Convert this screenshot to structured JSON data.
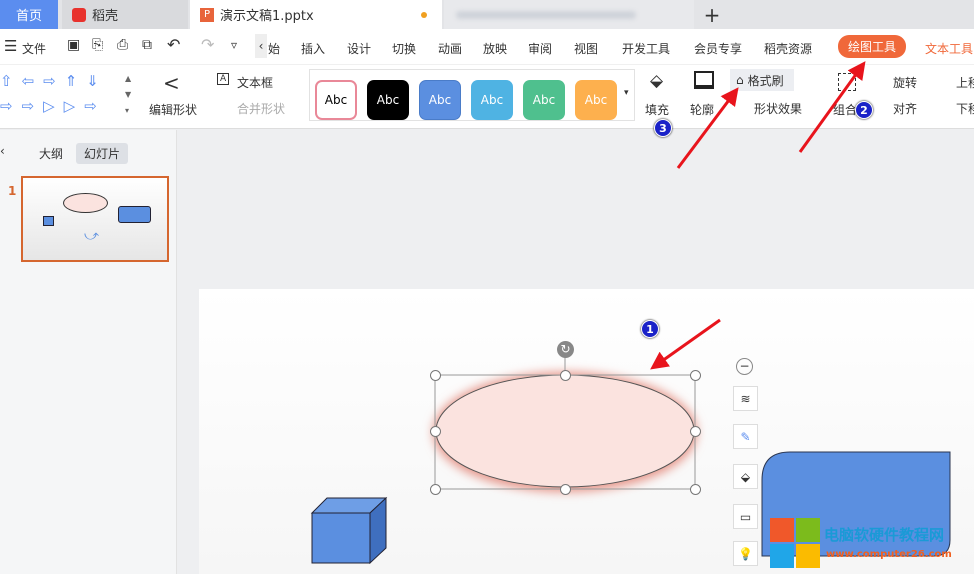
{
  "tabs": {
    "home": "首页",
    "daoke": "稻壳",
    "doc": "演示文稿1.pptx",
    "new_tab": "+"
  },
  "menu": {
    "file": "文件",
    "items": [
      "始",
      "插入",
      "设计",
      "切换",
      "动画",
      "放映",
      "审阅",
      "视图",
      "开发工具",
      "会员专享",
      "稻壳资源"
    ],
    "drawing_tools": "绘图工具",
    "text_tools": "文本工具"
  },
  "ribbon": {
    "edit_shape": "编辑形状",
    "text_box": "文本框",
    "merge_shape": "合并形状",
    "styles": [
      "Abc",
      "Abc",
      "Abc",
      "Abc",
      "Abc",
      "Abc"
    ],
    "fill": "填充",
    "outline": "轮廓",
    "format_painter": "格式刷",
    "shape_effects": "形状效果",
    "group": "组合",
    "rotate": "旋转",
    "align": "对齐",
    "move_up": "上移",
    "move_down": "下移"
  },
  "left_panel": {
    "outline_tab": "大纲",
    "slides_tab": "幻灯片",
    "slide_number": "1"
  },
  "annotations": [
    "1",
    "2",
    "3"
  ],
  "watermark": {
    "title": "电脑软硬件教程网",
    "url": "www.computer26.com"
  },
  "colors": {
    "accent": "#f0683a",
    "home_tab": "#5b8def",
    "arrow": "#e8141c",
    "shape_blue": "#5b8fe0",
    "ellipse_fill": "#fbe3df"
  }
}
